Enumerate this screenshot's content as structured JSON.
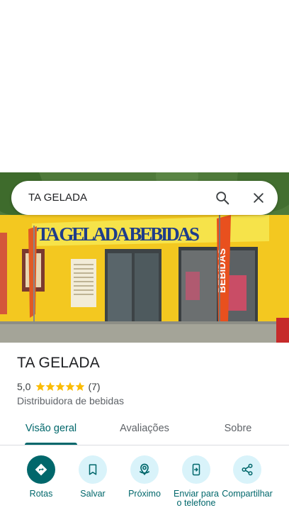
{
  "search": {
    "query": "TA GELADA",
    "search_icon": "search-icon",
    "close_icon": "close-icon"
  },
  "photo": {
    "sign_text": "TA GELADA BEBIDAS",
    "banner_text": "BEBIDAS"
  },
  "place": {
    "name": "TA GELADA",
    "rating": "5,0",
    "reviews": "(7)",
    "category": "Distribuidora de bebidas",
    "star_color": "#fbbc04"
  },
  "tabs": [
    {
      "label": "Visão geral",
      "active": true
    },
    {
      "label": "Avaliações",
      "active": false
    },
    {
      "label": "Sobre",
      "active": false
    }
  ],
  "actions": [
    {
      "label": "Rotas",
      "icon": "directions-icon"
    },
    {
      "label": "Salvar",
      "icon": "bookmark-icon"
    },
    {
      "label": "Próximo",
      "icon": "nearby-icon"
    },
    {
      "label": "Enviar para o telefone",
      "icon": "send-to-phone-icon"
    },
    {
      "label": "Compartilhar",
      "icon": "share-icon"
    }
  ],
  "colors": {
    "accent": "#00676b",
    "action_bg": "#d9f3fa",
    "divider": "#dadce0"
  }
}
